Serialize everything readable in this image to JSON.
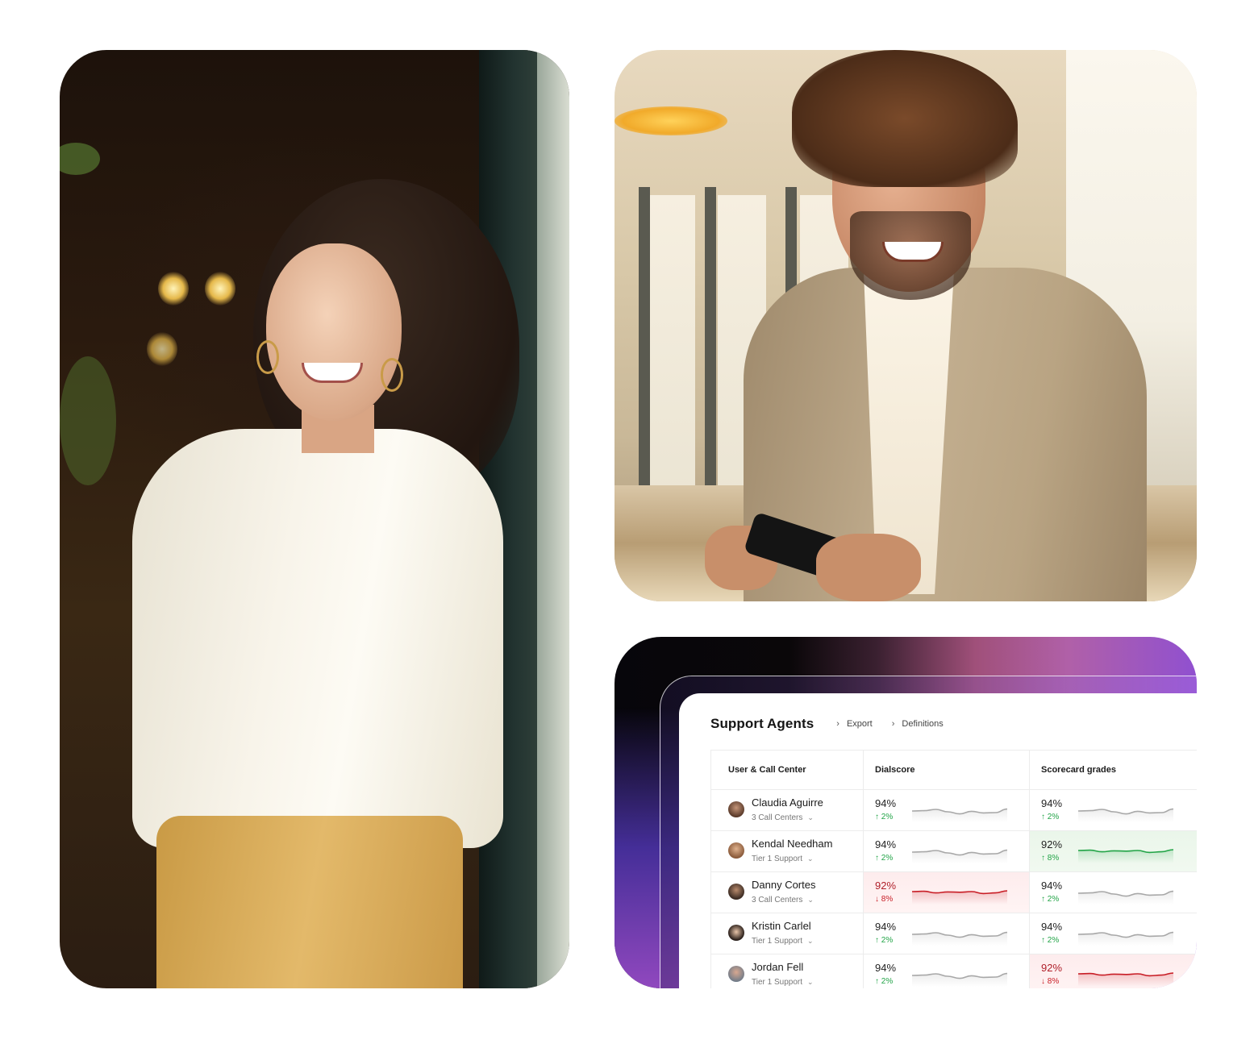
{
  "photos": [
    {
      "id": "woman",
      "alt": "Smiling woman in white blouse standing in a cafe doorway"
    },
    {
      "id": "man",
      "alt": "Smiling man in beige blazer looking at his phone in an office"
    }
  ],
  "dashboard": {
    "title": "Support Agents",
    "links": [
      {
        "label": "Export",
        "icon": "chevron-right-icon"
      },
      {
        "label": "Definitions",
        "icon": "chevron-right-icon"
      }
    ],
    "columns": [
      "User & Call Center",
      "Dialscore",
      "Scorecard grades"
    ],
    "colors": {
      "up": "#22a447",
      "down": "#c81d25",
      "neutral_line": "#a8a8a8",
      "good_line": "#22a447",
      "bad_line": "#c81d25",
      "gradient_start": "#07060b",
      "gradient_mid": "#a0507a",
      "gradient_end": "#9050d0"
    },
    "rows": [
      {
        "name": "Claudia Aguirre",
        "group": "3 Call Centers",
        "dialscore": {
          "value": "94%",
          "delta": "2%",
          "direction": "up",
          "status": "neutral",
          "trend": [
            0.5,
            0.52,
            0.6,
            0.45,
            0.32,
            0.48,
            0.38,
            0.4,
            0.62
          ]
        },
        "scorecard": {
          "value": "94%",
          "delta": "2%",
          "direction": "up",
          "status": "neutral",
          "trend": [
            0.5,
            0.52,
            0.6,
            0.45,
            0.32,
            0.48,
            0.38,
            0.4,
            0.62
          ]
        }
      },
      {
        "name": "Kendal Needham",
        "group": "Tier 1 Support",
        "dialscore": {
          "value": "94%",
          "delta": "2%",
          "direction": "up",
          "status": "neutral",
          "trend": [
            0.5,
            0.52,
            0.6,
            0.45,
            0.32,
            0.48,
            0.38,
            0.4,
            0.62
          ]
        },
        "scorecard": {
          "value": "92%",
          "delta": "8%",
          "direction": "up",
          "status": "good",
          "trend": [
            0.6,
            0.62,
            0.52,
            0.58,
            0.56,
            0.6,
            0.48,
            0.52,
            0.65
          ]
        }
      },
      {
        "name": "Danny Cortes",
        "group": "3 Call Centers",
        "dialscore": {
          "value": "92%",
          "delta": "8%",
          "direction": "down",
          "status": "bad",
          "trend": [
            0.6,
            0.62,
            0.52,
            0.58,
            0.56,
            0.6,
            0.48,
            0.52,
            0.65
          ]
        },
        "scorecard": {
          "value": "94%",
          "delta": "2%",
          "direction": "up",
          "status": "neutral",
          "trend": [
            0.5,
            0.52,
            0.6,
            0.45,
            0.32,
            0.48,
            0.38,
            0.4,
            0.62
          ]
        }
      },
      {
        "name": "Kristin Carlel",
        "group": "Tier 1 Support",
        "dialscore": {
          "value": "94%",
          "delta": "2%",
          "direction": "up",
          "status": "neutral",
          "trend": [
            0.5,
            0.52,
            0.6,
            0.45,
            0.32,
            0.48,
            0.38,
            0.4,
            0.62
          ]
        },
        "scorecard": {
          "value": "94%",
          "delta": "2%",
          "direction": "up",
          "status": "neutral",
          "trend": [
            0.5,
            0.52,
            0.6,
            0.45,
            0.32,
            0.48,
            0.38,
            0.4,
            0.62
          ]
        }
      },
      {
        "name": "Jordan Fell",
        "group": "Tier 1 Support",
        "dialscore": {
          "value": "94%",
          "delta": "2%",
          "direction": "up",
          "status": "neutral",
          "trend": [
            0.5,
            0.52,
            0.6,
            0.45,
            0.32,
            0.48,
            0.38,
            0.4,
            0.62
          ]
        },
        "scorecard": {
          "value": "92%",
          "delta": "8%",
          "direction": "down",
          "status": "bad",
          "trend": [
            0.6,
            0.62,
            0.52,
            0.58,
            0.56,
            0.6,
            0.48,
            0.52,
            0.65
          ]
        }
      }
    ],
    "icons": {
      "up_arrow": "↑",
      "down_arrow": "↓",
      "chevron_right": "›",
      "chevron_down": "⌄"
    }
  }
}
